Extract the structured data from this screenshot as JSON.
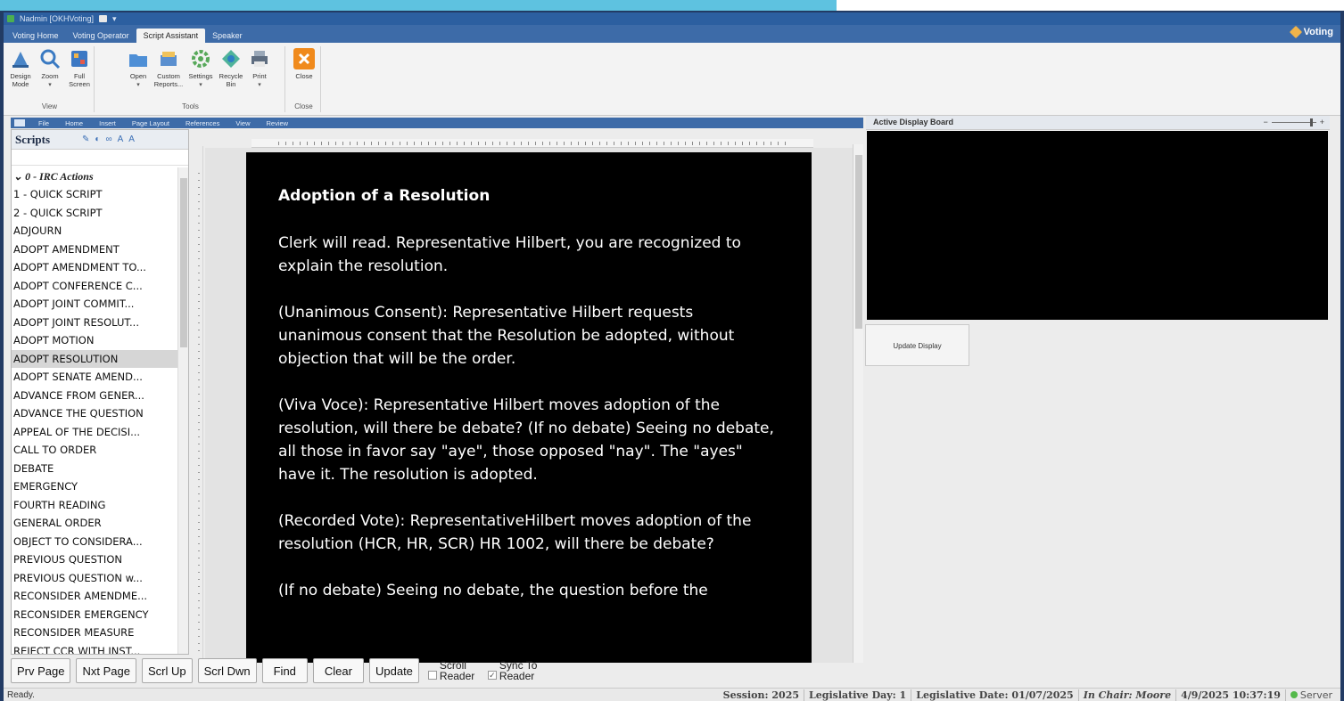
{
  "window": {
    "title": "Nadmin [OKHVoting]"
  },
  "ribbon_tabs": [
    "Voting Home",
    "Voting Operator",
    "Script Assistant",
    "Speaker"
  ],
  "active_ribbon_tab": "Script Assistant",
  "brand": "Voting",
  "ribbon_groups": {
    "view": {
      "name": "View",
      "buttons": [
        {
          "label": "Design Mode",
          "icon": "design-mode-icon"
        },
        {
          "label": "Zoom",
          "icon": "zoom-icon"
        },
        {
          "label": "Full Screen",
          "icon": "full-screen-icon"
        }
      ]
    },
    "tools": {
      "name": "Tools",
      "buttons": [
        {
          "label": "Open",
          "icon": "folder-icon"
        },
        {
          "label": "Custom Reports...",
          "icon": "reports-icon"
        },
        {
          "label": "Settings",
          "icon": "gear-icon"
        },
        {
          "label": "Recycle Bin",
          "icon": "recycle-icon"
        },
        {
          "label": "Print",
          "icon": "print-icon"
        }
      ]
    },
    "close": {
      "name": "Close",
      "buttons": [
        {
          "label": "Close",
          "icon": "close-icon"
        }
      ]
    }
  },
  "doc_tabs": [
    "File",
    "Home",
    "Insert",
    "Page Layout",
    "References",
    "View",
    "Review"
  ],
  "scripts": {
    "title": "Scripts",
    "group": "0 - IRC Actions",
    "items": [
      "1 - QUICK SCRIPT",
      "2 - QUICK SCRIPT",
      "ADJOURN",
      "ADOPT AMENDMENT",
      "ADOPT AMENDMENT TO...",
      "ADOPT CONFERENCE C...",
      "ADOPT JOINT COMMIT...",
      "ADOPT JOINT RESOLUT...",
      "ADOPT MOTION",
      "ADOPT RESOLUTION",
      "ADOPT SENATE AMEND...",
      "ADVANCE FROM GENER...",
      "ADVANCE THE QUESTION",
      "APPEAL OF THE DECISI...",
      "CALL TO ORDER",
      "DEBATE",
      "EMERGENCY",
      "FOURTH READING",
      "GENERAL ORDER",
      "OBJECT TO CONSIDERA...",
      "PREVIOUS QUESTION",
      "PREVIOUS QUESTION w...",
      "RECONSIDER AMENDME...",
      "RECONSIDER EMERGENCY",
      "RECONSIDER MEASURE",
      "REJECT CCR WITH INST..."
    ],
    "selected": "ADOPT RESOLUTION"
  },
  "document": {
    "heading": "Adoption of a Resolution",
    "paragraphs": [
      "Clerk will read. Representative Hilbert, you are recognized to explain the resolution.",
      "(Unanimous Consent): Representative Hilbert requests unanimous consent that the Resolution be adopted, without objection that will be the order.",
      "(Viva Voce): Representative Hilbert moves adoption of the resolution, will there be debate?  (If no debate)  Seeing no debate, all those in favor say \"aye\", those opposed  \"nay\". The \"ayes\" have it.  The resolution is adopted.",
      "(Recorded Vote): RepresentativeHilbert moves adoption of the resolution (HCR, HR, SCR) HR 1002, will there be debate?",
      "(If no debate)  Seeing no debate, the question before the"
    ]
  },
  "display_board": {
    "title": "Active Display Board",
    "zoom_minus": "−",
    "zoom_plus": "+",
    "update_button": "Update Display"
  },
  "bottom_buttons": [
    "Prv Page",
    "Nxt Page",
    "Scrl Up",
    "Scrl Dwn",
    "Find",
    "Clear",
    "Update"
  ],
  "checkboxes": [
    {
      "label": "Scroll Reader",
      "checked": false
    },
    {
      "label": "Sync To Reader",
      "checked": true
    }
  ],
  "status": {
    "ready": "Ready.",
    "session": "Session: 2025",
    "legislative_day": "Legislative Day: 1",
    "legislative_date": "Legislative Date: 01/07/2025",
    "in_chair": "In Chair: Moore",
    "timestamp": "4/9/2025 10:37:19",
    "server": "Server"
  },
  "colors": {
    "navy_frame": "#223b64",
    "ribbon_blue": "#3d6ba8",
    "teal_band": "#5ec2e0",
    "document_bg": "#000000"
  }
}
